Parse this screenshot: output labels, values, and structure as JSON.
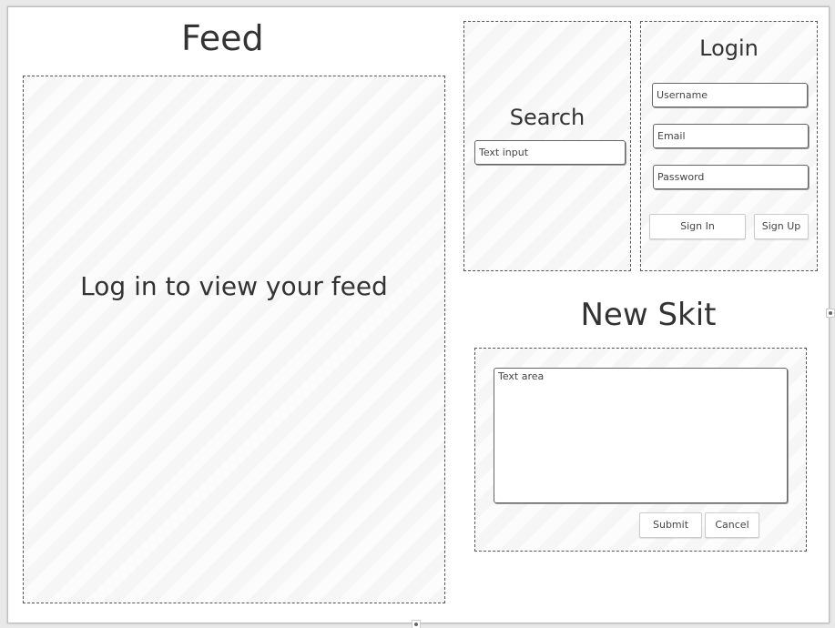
{
  "feed": {
    "title": "Feed",
    "message": "Log in to view your feed"
  },
  "search": {
    "title": "Search",
    "input_placeholder": "Text input"
  },
  "login": {
    "title": "Login",
    "username_placeholder": "Username",
    "email_placeholder": "Email",
    "password_placeholder": "Password",
    "sign_in_label": "Sign In",
    "sign_up_label": "Sign Up"
  },
  "new_skit": {
    "title": "New Skit",
    "textarea_placeholder": "Text area",
    "submit_label": "Submit",
    "cancel_label": "Cancel"
  }
}
